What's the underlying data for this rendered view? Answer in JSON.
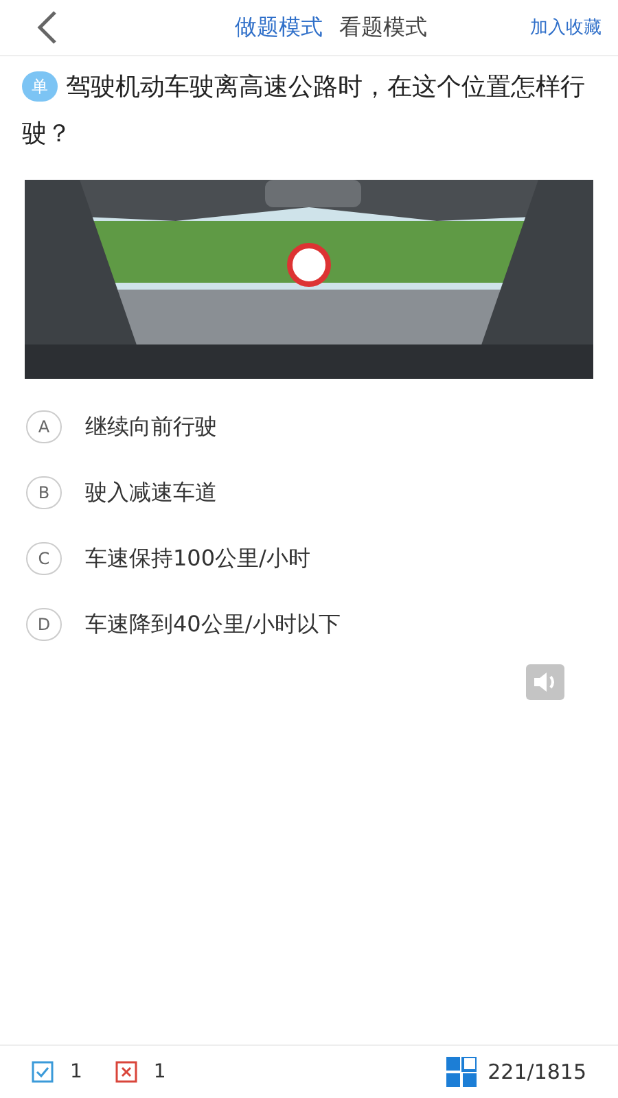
{
  "header": {
    "tabs": [
      {
        "label": "做题模式",
        "selected": true
      },
      {
        "label": "看题模式",
        "selected": false
      }
    ],
    "favorite": "加入收藏"
  },
  "question": {
    "type_badge": "单",
    "text": "驾驶机动车驶离高速公路时，在这个位置怎样行驶？"
  },
  "options": [
    {
      "letter": "A",
      "text": "继续向前行驶"
    },
    {
      "letter": "B",
      "text": "驶入减速车道"
    },
    {
      "letter": "C",
      "text": "车速保持100公里/小时"
    },
    {
      "letter": "D",
      "text": "车速降到40公里/小时以下"
    }
  ],
  "footer": {
    "correct_count": "1",
    "wrong_count": "1",
    "progress": "221/1815"
  }
}
